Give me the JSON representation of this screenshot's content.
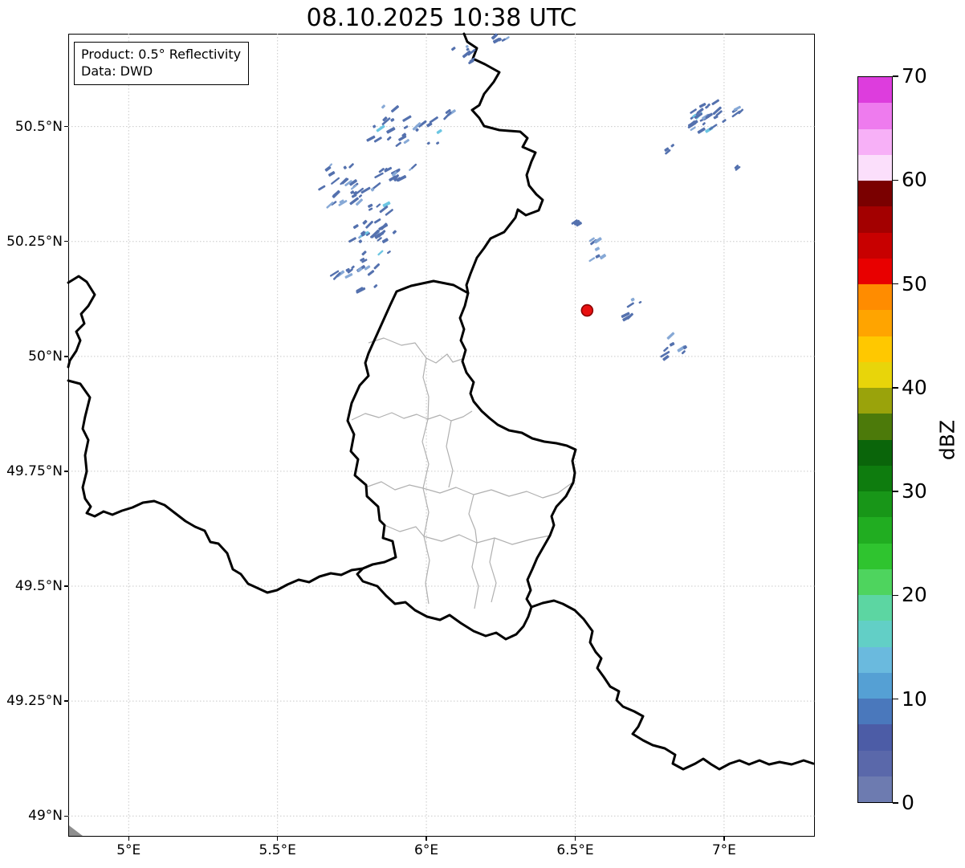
{
  "title": "08.10.2025 10:38 UTC",
  "info_box": {
    "product": "Product: 0.5° Reflectivity",
    "data": "Data: DWD"
  },
  "chart_data": {
    "type": "radar-reflectivity-map",
    "title": "08.10.2025 10:38 UTC",
    "x_axis": {
      "tick_values": [
        5,
        5.5,
        6,
        6.5,
        7
      ],
      "tick_labels": [
        "5°E",
        "5.5°E",
        "6°E",
        "6.5°E",
        "7°E"
      ],
      "range": [
        4.797,
        7.305
      ]
    },
    "y_axis": {
      "tick_values": [
        50.5,
        50.25,
        50,
        49.75,
        49.5,
        49.25,
        49
      ],
      "tick_labels": [
        "50.5°N",
        "50.25°N",
        "50°N",
        "49.75°N",
        "49.5°N",
        "49.25°N",
        "49°N"
      ],
      "range": [
        48.955,
        50.702
      ]
    },
    "grid": {
      "on": true,
      "style": "dotted",
      "color": "#c9c9c9"
    },
    "colorbar": {
      "label": "dBZ",
      "min": 0,
      "max": 70,
      "tick_values": [
        0,
        10,
        20,
        30,
        40,
        50,
        60,
        70
      ],
      "segment_step": 2.5,
      "colors_bottom_to_top": [
        "#6d7bb0",
        "#5a68aa",
        "#4c5ca6",
        "#4a78bc",
        "#55a0d4",
        "#6abade",
        "#62cfc6",
        "#5cd6a2",
        "#4ed45e",
        "#2fc42f",
        "#21ad21",
        "#189618",
        "#0e7c0e",
        "#0a650a",
        "#4c7a0a",
        "#9aa30b",
        "#e8d50a",
        "#ffc800",
        "#ffa400",
        "#ff8c00",
        "#e80000",
        "#c80000",
        "#a30000",
        "#7a0000",
        "#fbdffb",
        "#f7b0f7",
        "#ee7bee",
        "#dd3ddd"
      ]
    },
    "radar_site_marker": {
      "lon": 6.54,
      "lat": 50.1,
      "fill": "#e81010",
      "edge": "#8b0000",
      "radius_px": 7
    },
    "echo_colors": {
      "base": "#5471ae",
      "light": "#87a9d6",
      "cyan": "#6cc6e2"
    },
    "echo_clusters": [
      {
        "lon": 5.93,
        "lat": 50.496,
        "rx": 0.108,
        "ry": 0.049,
        "n": 26,
        "cyan": true,
        "peak_dbz": 15
      },
      {
        "lon": 5.727,
        "lat": 50.37,
        "rx": 0.102,
        "ry": 0.044,
        "n": 30,
        "cyan": false,
        "peak_dbz": 10
      },
      {
        "lon": 5.889,
        "lat": 50.405,
        "rx": 0.067,
        "ry": 0.031,
        "n": 14,
        "cyan": false,
        "peak_dbz": 10
      },
      {
        "lon": 5.835,
        "lat": 50.269,
        "rx": 0.094,
        "ry": 0.061,
        "n": 30,
        "cyan": true,
        "peak_dbz": 18
      },
      {
        "lon": 5.787,
        "lat": 50.19,
        "rx": 0.049,
        "ry": 0.049,
        "n": 12,
        "cyan": false,
        "peak_dbz": 10
      },
      {
        "lon": 5.714,
        "lat": 50.176,
        "rx": 0.032,
        "ry": 0.014,
        "n": 6,
        "cyan": false,
        "peak_dbz": 8
      },
      {
        "lon": 6.127,
        "lat": 50.658,
        "rx": 0.043,
        "ry": 0.021,
        "n": 7,
        "cyan": false,
        "peak_dbz": 8
      },
      {
        "lon": 6.24,
        "lat": 50.692,
        "rx": 0.038,
        "ry": 0.012,
        "n": 5,
        "cyan": false,
        "peak_dbz": 8
      },
      {
        "lon": 6.928,
        "lat": 50.522,
        "rx": 0.086,
        "ry": 0.035,
        "n": 26,
        "cyan": true,
        "peak_dbz": 14
      },
      {
        "lon": 7.044,
        "lat": 50.531,
        "rx": 0.022,
        "ry": 0.014,
        "n": 4,
        "cyan": false,
        "peak_dbz": 8
      },
      {
        "lon": 6.817,
        "lat": 50.454,
        "rx": 0.016,
        "ry": 0.01,
        "n": 3,
        "cyan": false,
        "peak_dbz": 8
      },
      {
        "lon": 7.046,
        "lat": 50.412,
        "rx": 0.013,
        "ry": 0.007,
        "n": 2,
        "cyan": false,
        "peak_dbz": 8
      },
      {
        "lon": 6.488,
        "lat": 50.295,
        "rx": 0.024,
        "ry": 0.012,
        "n": 4,
        "cyan": false,
        "peak_dbz": 8
      },
      {
        "lon": 6.563,
        "lat": 50.243,
        "rx": 0.019,
        "ry": 0.017,
        "n": 4,
        "cyan": false,
        "peak_dbz": 8
      },
      {
        "lon": 6.577,
        "lat": 50.215,
        "rx": 0.032,
        "ry": 0.007,
        "n": 3,
        "cyan": false,
        "peak_dbz": 8
      },
      {
        "lon": 6.709,
        "lat": 50.115,
        "rx": 0.022,
        "ry": 0.01,
        "n": 3,
        "cyan": false,
        "peak_dbz": 8
      },
      {
        "lon": 6.674,
        "lat": 50.087,
        "rx": 0.022,
        "ry": 0.009,
        "n": 3,
        "cyan": false,
        "peak_dbz": 8
      },
      {
        "lon": 6.828,
        "lat": 50.014,
        "rx": 0.043,
        "ry": 0.031,
        "n": 8,
        "cyan": false,
        "peak_dbz": 10
      },
      {
        "lon": 6.078,
        "lat": 50.531,
        "rx": 0.016,
        "ry": 0.009,
        "n": 3,
        "cyan": false,
        "peak_dbz": 8
      }
    ],
    "map_features": {
      "national_border_color": "#000000",
      "subdivision_border_color": "#b0b0b0",
      "background_color": "#ffffff"
    }
  }
}
